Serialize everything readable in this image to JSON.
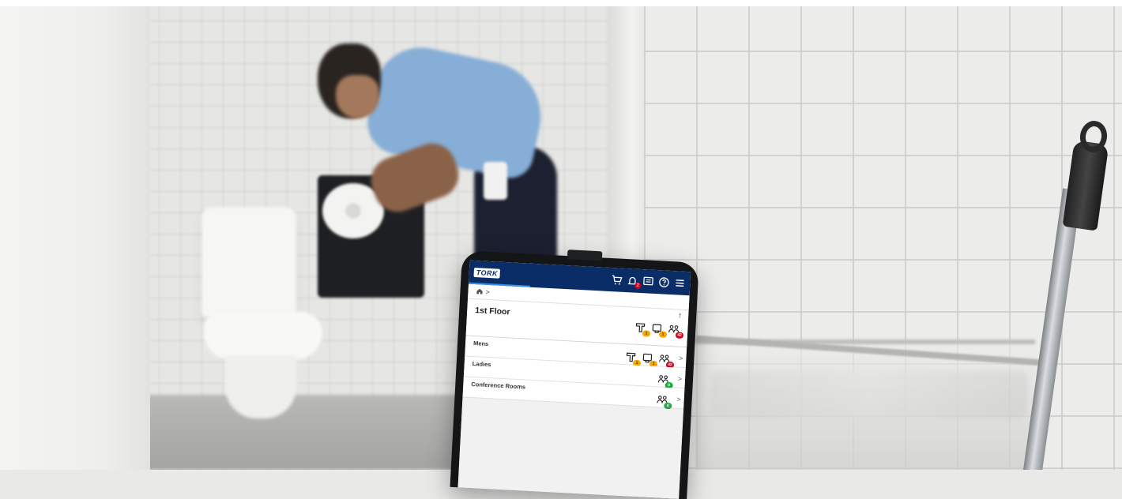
{
  "app": {
    "logo_text": "TORK",
    "brand_color": "#0b2d67",
    "accent_color": "#3b8ee8",
    "header_icons": [
      {
        "name": "cart-icon"
      },
      {
        "name": "bell-icon",
        "badge": "2"
      },
      {
        "name": "message-icon"
      },
      {
        "name": "help-icon"
      },
      {
        "name": "menu-icon"
      }
    ]
  },
  "breadcrumb": {
    "separator": ">"
  },
  "floor": {
    "title": "1st Floor",
    "collapse_symbol": "↑",
    "status": [
      {
        "icon": "paper-towel-dispenser-icon",
        "badge": "1",
        "badge_color": "#f5a800"
      },
      {
        "icon": "toilet-paper-dispenser-icon",
        "badge": "1",
        "badge_color": "#f5a800"
      },
      {
        "icon": "people-counter-icon",
        "badge": "42",
        "badge_color": "#d0021b"
      }
    ]
  },
  "rooms": [
    {
      "label": "Mens",
      "chevron": ">",
      "status": [
        {
          "icon": "paper-towel-dispenser-icon",
          "badge": "1",
          "badge_color": "#f5a800"
        },
        {
          "icon": "toilet-paper-dispenser-icon",
          "badge": "1",
          "badge_color": "#f5a800"
        },
        {
          "icon": "people-counter-icon",
          "badge": "42",
          "badge_color": "#d0021b"
        }
      ]
    },
    {
      "label": "Ladies",
      "chevron": ">",
      "status": [
        {
          "icon": "people-counter-icon",
          "badge": "0",
          "badge_color": "#27a844"
        }
      ]
    },
    {
      "label": "Conference Rooms",
      "chevron": ">",
      "status": [
        {
          "icon": "people-counter-icon",
          "badge": "0",
          "badge_color": "#27a844"
        }
      ]
    }
  ]
}
